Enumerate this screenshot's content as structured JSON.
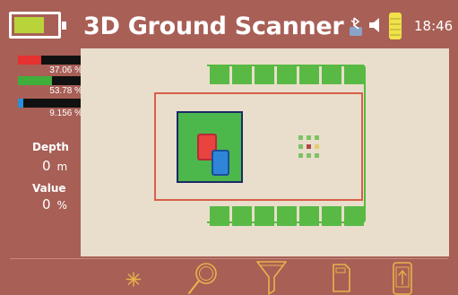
{
  "header": {
    "title": "3D Ground Scanner",
    "time": "18:46",
    "battery_level": 0.72
  },
  "channels": [
    {
      "value_text": "37.06 %",
      "level": 0.3706,
      "color": "#e5312f"
    },
    {
      "value_text": "53.78 %",
      "level": 0.5378,
      "color": "#3fae3a"
    },
    {
      "value_text": "9.156 %",
      "level": 0.0916,
      "color": "#2a8fd8"
    }
  ],
  "stats": {
    "depth_label": "Depth",
    "depth_value": "0",
    "depth_unit": "m",
    "value_label": "Value",
    "value_value": "0",
    "value_unit": "%"
  },
  "colors": {
    "background": "#a85f56",
    "scan_area": "#e9decb",
    "grid_green": "#58ba44",
    "frame_red": "#d95f4a",
    "target_red": "#e8433f",
    "target_blue": "#2f86d8"
  },
  "toolbar": {
    "icons": [
      "sparkle-icon",
      "magnifier-icon",
      "filter-icon",
      "sd-card-icon",
      "phone-export-icon"
    ]
  }
}
